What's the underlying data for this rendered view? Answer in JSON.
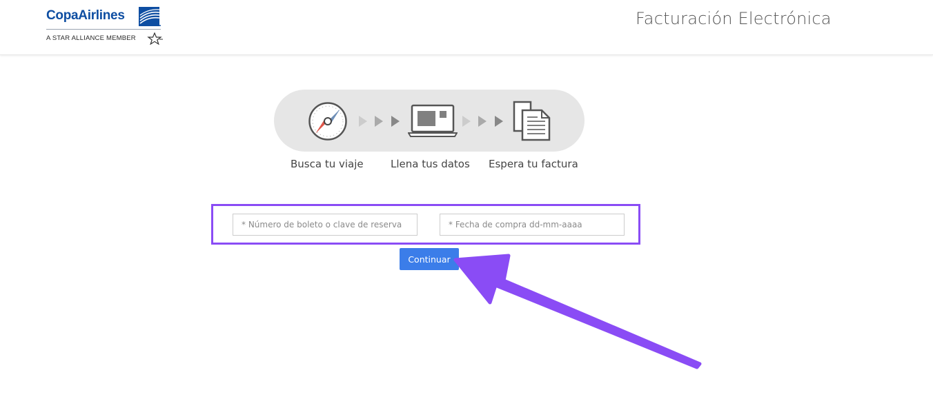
{
  "header": {
    "brand": "CopaAirlines",
    "tagline": "A STAR ALLIANCE MEMBER",
    "title": "Facturación Electrónica"
  },
  "colors": {
    "brand_blue": "#0e4ea2",
    "button_blue": "#3b7de9",
    "highlight_purple": "#8a4cf5",
    "step_pill_gray": "#e6e6e6"
  },
  "steps": [
    {
      "label": "Busca tu viaje",
      "icon": "compass-icon"
    },
    {
      "label": "Llena tus datos",
      "icon": "laptop-icon"
    },
    {
      "label": "Espera tu factura",
      "icon": "documents-icon"
    }
  ],
  "form": {
    "ticket_placeholder": "* Número de boleto o clave de reserva",
    "date_placeholder": "* Fecha de compra dd-mm-aaaa",
    "submit_label": "Continuar"
  }
}
